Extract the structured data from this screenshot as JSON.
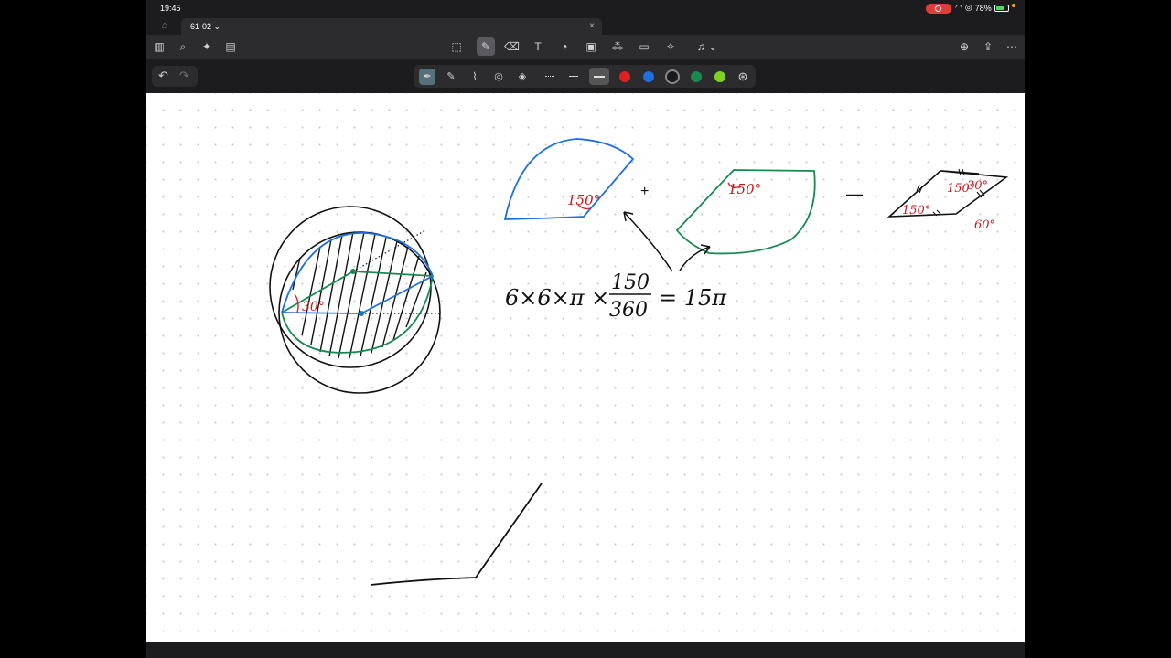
{
  "status": {
    "time": "19:45",
    "battery": "78%"
  },
  "tab": {
    "title": "61-02 ⌄",
    "close": "×"
  },
  "toolbar": {
    "left_icons": [
      "sidebar-icon",
      "search-icon",
      "sparkle-icon",
      "notes-icon"
    ],
    "center_icons": [
      "lasso-select-icon",
      "pen-icon",
      "eraser-icon",
      "text-box-icon",
      "shapes-icon",
      "image-icon",
      "sticker-icon",
      "comment-icon",
      "laser-pointer-icon",
      "microphone-icon"
    ],
    "right_icons": [
      "new-page-icon",
      "share-icon",
      "more-icon"
    ]
  },
  "pen_colors": [
    "#1a1a1a",
    "#e02020",
    "#1e6fe0",
    "#1a1a1a",
    "#178a50",
    "#7ed321"
  ],
  "canvas": {
    "angle_label_1": "150°",
    "angle_label_2": "150°",
    "angle_label_3": "30°",
    "angle_label_4": "30°",
    "angle_label_5": "150°",
    "angle_label_6": "60°",
    "angle_label_7": "150°",
    "plus": "+",
    "minus": "—",
    "equation": {
      "lhs": "6×6×π ×",
      "num": "150",
      "den": "360",
      "rhs": "= 15π"
    }
  }
}
